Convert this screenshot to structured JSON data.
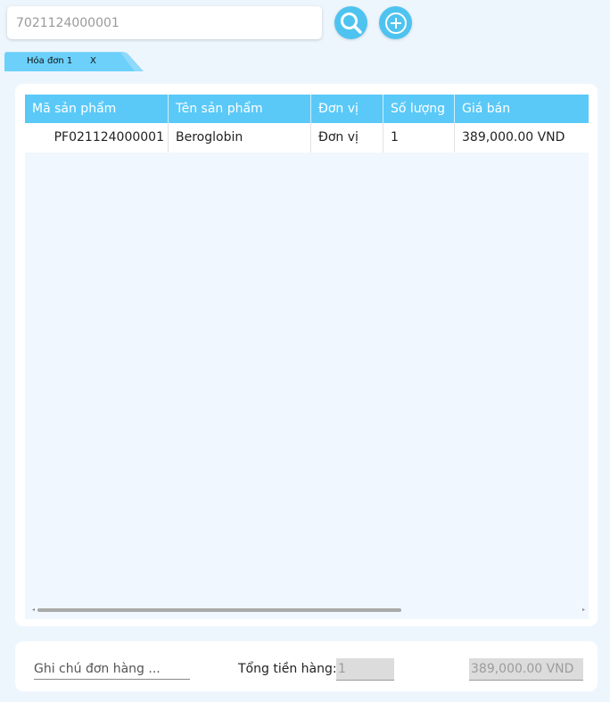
{
  "search": {
    "value": "7021124000001"
  },
  "tabs": [
    {
      "label": "Hóa đơn 1",
      "close": "X"
    }
  ],
  "table": {
    "columns": [
      "Mã sản phẩm",
      "Tên sản phẩm",
      "Đơn vị",
      "Số lượng",
      "Giá bán"
    ],
    "rows": [
      {
        "code": "PF021124000001",
        "name": "Beroglobin",
        "unit": "Đơn vị",
        "qty": "1",
        "price": "389,000.00 VND"
      }
    ]
  },
  "footer": {
    "note_placeholder": "Ghi chú đơn hàng ...",
    "total_label": "Tổng tiền hàng:",
    "total_qty": "1",
    "total_amount": "389,000.00 VND"
  },
  "icons": {
    "search": "search-icon",
    "add": "plus-circle-icon"
  },
  "colors": {
    "accent": "#5ac9f8",
    "button": "#4fc3f0",
    "background": "#eef6fd"
  }
}
